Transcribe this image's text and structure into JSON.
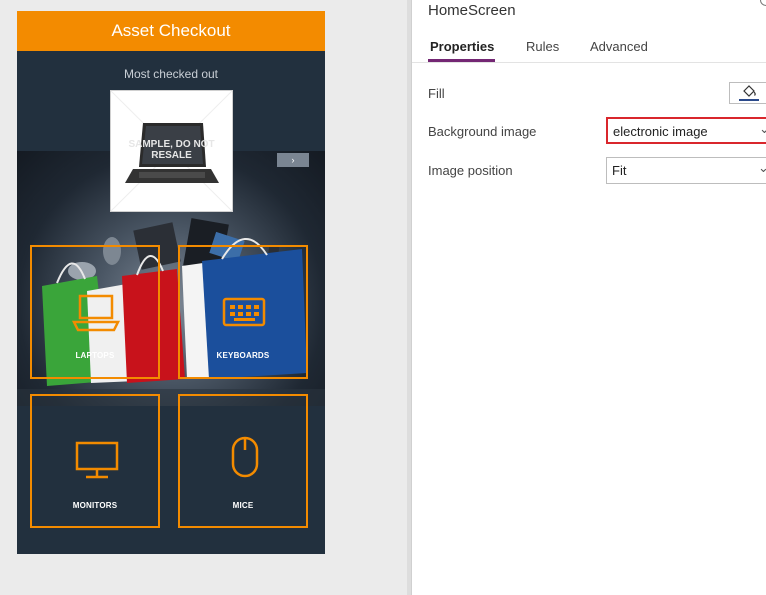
{
  "phone": {
    "header_title": "Asset Checkout",
    "section_label": "Most checked out",
    "watermark": "SAMPLE, DO NOT RESALE",
    "next_arrow": "›",
    "tiles": [
      {
        "label": "LAPTOPS",
        "icon": "laptop-icon"
      },
      {
        "label": "KEYBOARDS",
        "icon": "keyboard-icon"
      },
      {
        "label": "MONITORS",
        "icon": "monitor-icon"
      },
      {
        "label": "MICE",
        "icon": "mouse-icon"
      }
    ],
    "colors": {
      "header": "#f38b00",
      "background": "#22303e",
      "tile_border": "#f38b00"
    }
  },
  "panel": {
    "screen_name": "HomeScreen",
    "tabs": [
      {
        "label": "Properties",
        "active": true
      },
      {
        "label": "Rules",
        "active": false
      },
      {
        "label": "Advanced",
        "active": false
      }
    ],
    "properties": {
      "fill_label": "Fill",
      "fill_icon": "paint-bucket-icon",
      "background_image_label": "Background image",
      "background_image_value": "electronic image",
      "image_position_label": "Image position",
      "image_position_value": "Fit",
      "chevron": "⌄"
    },
    "colors": {
      "accent": "#742774",
      "highlight": "#d9262c"
    }
  }
}
